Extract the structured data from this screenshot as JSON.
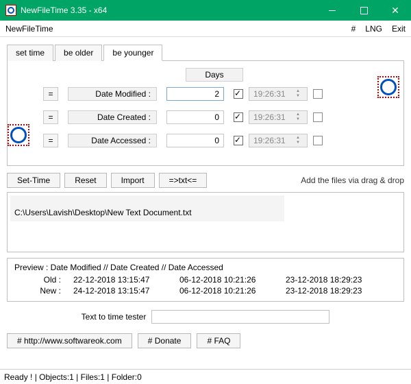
{
  "window": {
    "title": "NewFileTime 3.35 - x64"
  },
  "menubar": {
    "app_name": "NewFileTime",
    "hash": "#",
    "lng": "LNG",
    "exit": "Exit"
  },
  "tabs": {
    "set_time": "set time",
    "be_older": "be older",
    "be_younger": "be younger"
  },
  "panel": {
    "days_label": "Days",
    "rows": [
      {
        "eq": "=",
        "label": "Date Modified :",
        "value": "2",
        "checked": true,
        "time": "19:26:31"
      },
      {
        "eq": "=",
        "label": "Date Created :",
        "value": "0",
        "checked": true,
        "time": "19:26:31"
      },
      {
        "eq": "=",
        "label": "Date Accessed :",
        "value": "0",
        "checked": true,
        "time": "19:26:31"
      }
    ]
  },
  "actions": {
    "set_time": "Set-Time",
    "reset": "Reset",
    "import": "Import",
    "txt": "=>txt<=",
    "drag_hint": "Add the files via drag & drop"
  },
  "file_path": "C:\\Users\\Lavish\\Desktop\\New Text Document.txt",
  "preview": {
    "head": "Preview  :    Date Modified    //   Date Created    //   Date Accessed",
    "old_label": "Old :",
    "new_label": "New :",
    "old": [
      "22-12-2018 13:15:47",
      "06-12-2018 10:21:26",
      "23-12-2018 18:29:23"
    ],
    "new": [
      "24-12-2018 13:15:47",
      "06-12-2018 10:21:26",
      "23-12-2018 18:29:23"
    ]
  },
  "tester_label": "Text to time tester",
  "links": {
    "site": "# http://www.softwareok.com",
    "donate": "# Donate",
    "faq": "# FAQ"
  },
  "status": "Ready ! | Objects:1 | Files:1 | Folder:0"
}
